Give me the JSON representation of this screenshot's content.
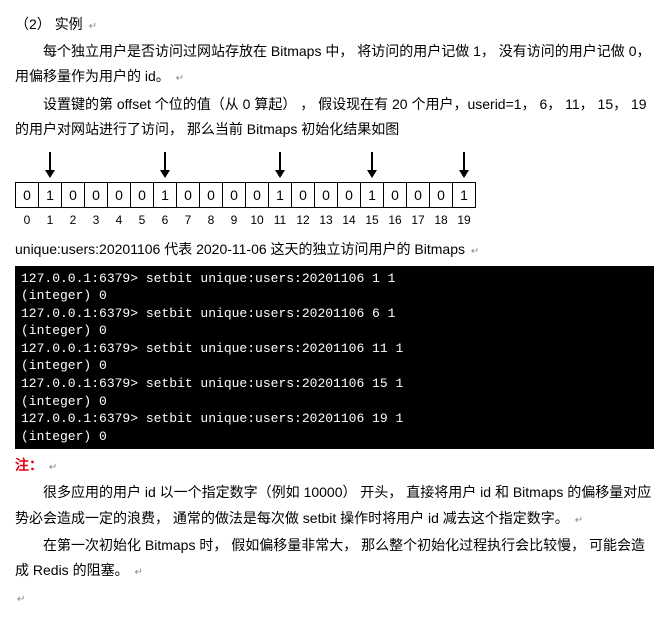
{
  "section": {
    "num": "（2）",
    "title": "实例"
  },
  "paragraphs": {
    "p1": "每个独立用户是否访问过网站存放在 Bitmaps 中， 将访问的用户记做 1， 没有访问的用户记做 0， 用偏移量作为用户的 id。",
    "p2": "设置键的第 offset 个位的值（从 0 算起） ， 假设现在有 20 个用户，userid=1， 6， 11， 15， 19 的用户对网站进行了访问， 那么当前 Bitmaps 初始化结果如图",
    "p3": "unique:users:20201106 代表 2020-11-06 这天的独立访问用户的 Bitmaps",
    "p4": "很多应用的用户 id 以一个指定数字（例如 10000） 开头， 直接将用户 id 和 Bitmaps 的偏移量对应势必会造成一定的浪费， 通常的做法是每次做 setbit 操作时将用户 id 减去这个指定数字。",
    "p5": "在第一次初始化 Bitmaps 时， 假如偏移量非常大， 那么整个初始化过程执行会比较慢， 可能会造成 Redis 的阻塞。"
  },
  "note_label": "注：",
  "pilcrow": "↵",
  "chart_data": {
    "type": "table",
    "description": "Bitmap array of 20 bits showing user visit flags",
    "arrows_at": [
      1,
      6,
      11,
      15,
      19
    ],
    "bits": [
      0,
      1,
      0,
      0,
      0,
      0,
      1,
      0,
      0,
      0,
      0,
      1,
      0,
      0,
      0,
      1,
      0,
      0,
      0,
      1
    ],
    "indices": [
      0,
      1,
      2,
      3,
      4,
      5,
      6,
      7,
      8,
      9,
      10,
      11,
      12,
      13,
      14,
      15,
      16,
      17,
      18,
      19
    ]
  },
  "terminal": [
    "127.0.0.1:6379> setbit unique:users:20201106 1 1",
    "(integer) 0",
    "127.0.0.1:6379> setbit unique:users:20201106 6 1",
    "(integer) 0",
    "127.0.0.1:6379> setbit unique:users:20201106 11 1",
    "(integer) 0",
    "127.0.0.1:6379> setbit unique:users:20201106 15 1",
    "(integer) 0",
    "127.0.0.1:6379> setbit unique:users:20201106 19 1",
    "(integer) 0"
  ]
}
